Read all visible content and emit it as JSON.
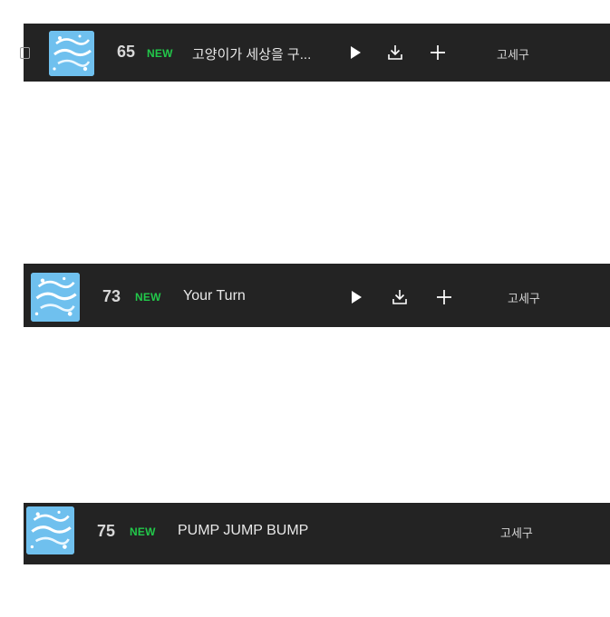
{
  "colors": {
    "row_background": "#232323",
    "new_badge": "#22c84a",
    "album_art": "#6fc0ee",
    "text": "#e8e8e8"
  },
  "tracks": [
    {
      "rank": "65",
      "badge": "NEW",
      "title": "고양이가 세상을 구...",
      "artist": "고세구",
      "actions": [
        "play-icon",
        "download-icon",
        "plus-icon"
      ]
    },
    {
      "rank": "73",
      "badge": "NEW",
      "title": "Your Turn",
      "artist": "고세구",
      "actions": [
        "play-icon",
        "download-icon",
        "plus-icon"
      ]
    },
    {
      "rank": "75",
      "badge": "NEW",
      "title": "PUMP JUMP BUMP",
      "artist": "고세구",
      "actions": []
    }
  ]
}
